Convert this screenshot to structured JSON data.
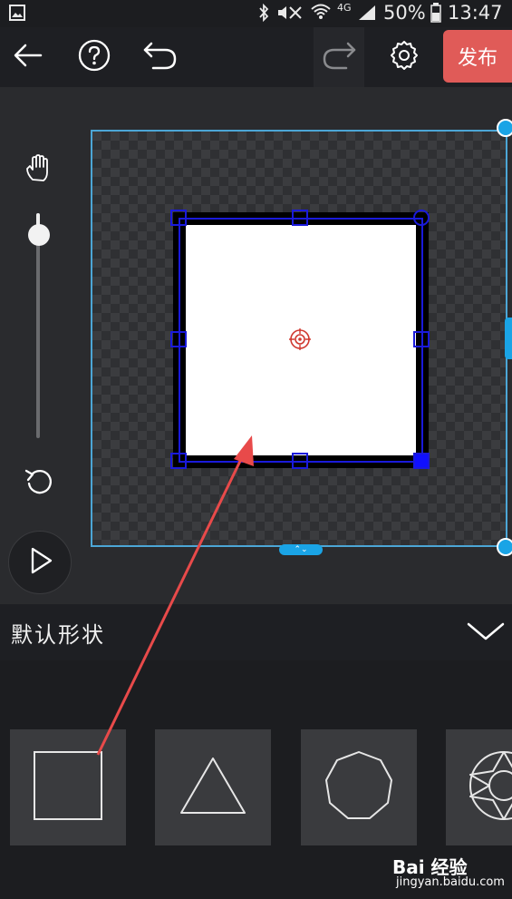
{
  "status_bar": {
    "battery": "50%",
    "time": "13:47",
    "network": "4G"
  },
  "toolbar": {
    "back_icon": "arrow-left-icon",
    "help_icon": "question-circle-icon",
    "undo_icon": "undo-icon",
    "redo_icon": "redo-icon",
    "settings_icon": "gear-icon",
    "publish_label": "发布",
    "accent": "#e05b58"
  },
  "editor": {
    "zoom_level": 0.05,
    "canvas_border_color": "#4ca6d6",
    "selection_color": "#1a1adb"
  },
  "panel": {
    "title": "默认形状",
    "shapes": [
      "square",
      "triangle",
      "nonagon",
      "gem"
    ]
  },
  "watermark": {
    "brand": "Bai 经验",
    "url": "jingyan.baidu.com"
  }
}
